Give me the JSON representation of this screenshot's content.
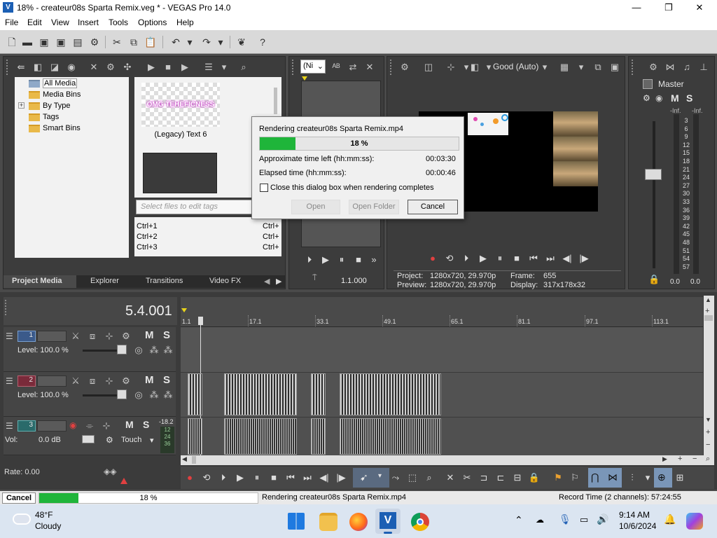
{
  "window": {
    "title": "18% - createur08s Sparta Remix.veg * - VEGAS Pro 14.0",
    "minimize": "—",
    "maximize": "❐",
    "close": "✕"
  },
  "menu": [
    "File",
    "Edit",
    "View",
    "Insert",
    "Tools",
    "Options",
    "Help"
  ],
  "project_media": {
    "tree": [
      "All Media",
      "Media Bins",
      "By Type",
      "Tags",
      "Smart Bins"
    ],
    "expander": "+",
    "media_item_label": "(Legacy) Text 6",
    "media_thumb_text": "OMG TEHEFICNESS",
    "tag_placeholder": "Select files to edit tags",
    "shortcuts": [
      "Ctrl+1",
      "Ctrl+2",
      "Ctrl+3"
    ],
    "shortcuts_right": [
      "Ctrl+",
      "Ctrl+",
      "Ctrl+"
    ],
    "tabs": [
      "Project Media",
      "Explorer",
      "Transitions",
      "Video FX"
    ]
  },
  "trimmer": {
    "dropdown_value": "(Ni",
    "timecode": "1.1.000"
  },
  "preview": {
    "quality": "Good (Auto)",
    "project_label": "Project:",
    "project_value": "1280x720, 29.970p",
    "preview_label": "Preview:",
    "preview_value": "1280x720, 29.970p",
    "frame_label": "Frame:",
    "frame_value": "655",
    "display_label": "Display:",
    "display_value": "317x178x32"
  },
  "master": {
    "title": "Master",
    "inf_left": "-Inf.",
    "inf_right": "-Inf.",
    "scale": [
      "3",
      "6",
      "9",
      "12",
      "15",
      "18",
      "21",
      "24",
      "27",
      "30",
      "33",
      "36",
      "39",
      "42",
      "45",
      "48",
      "51",
      "54",
      "57"
    ],
    "val_left": "0.0",
    "val_right": "0.0",
    "m_label": "M",
    "s_label": "S"
  },
  "render_dialog": {
    "title": "Rendering createur08s Sparta Remix.mp4",
    "progress_percent": 18,
    "progress_text": "18 %",
    "time_left_label": "Approximate time left (hh:mm:ss):",
    "time_left_value": "00:03:30",
    "elapsed_label": "Elapsed time (hh:mm:ss):",
    "elapsed_value": "00:00:46",
    "checkbox_label": "Close this dialog box when rendering completes",
    "open_label": "Open",
    "open_folder_label": "Open Folder",
    "cancel_label": "Cancel"
  },
  "timeline": {
    "cursor_time": "5.4.001",
    "ruler": [
      "1.1",
      "17.1",
      "33.1",
      "49.1",
      "65.1",
      "81.1",
      "97.1",
      "113.1"
    ],
    "tracks": [
      {
        "num": "1",
        "level": "Level: 100.0 %"
      },
      {
        "num": "2",
        "level": "Level: 100.0 %"
      },
      {
        "num": "3",
        "vol_label": "Vol:",
        "vol_value": "0.0 dB",
        "automation": "Touch",
        "meter_top": "-18.2",
        "meter_vals": [
          "12",
          "24",
          "36"
        ]
      }
    ],
    "rate": "Rate: 0.00",
    "m": "M",
    "s": "S"
  },
  "status": {
    "cancel_label": "Cancel",
    "progress_percent": 18,
    "progress_text": "18 %",
    "message": "Rendering createur08s Sparta Remix.mp4",
    "record_time": "Record Time (2 channels): 57:24:55"
  },
  "taskbar": {
    "temperature": "48°F",
    "weather": "Cloudy",
    "time": "9:14 AM",
    "date": "10/6/2024"
  },
  "colors": {
    "progress_green": "#1fb53a",
    "accent_blue": "#1c5fb4"
  }
}
